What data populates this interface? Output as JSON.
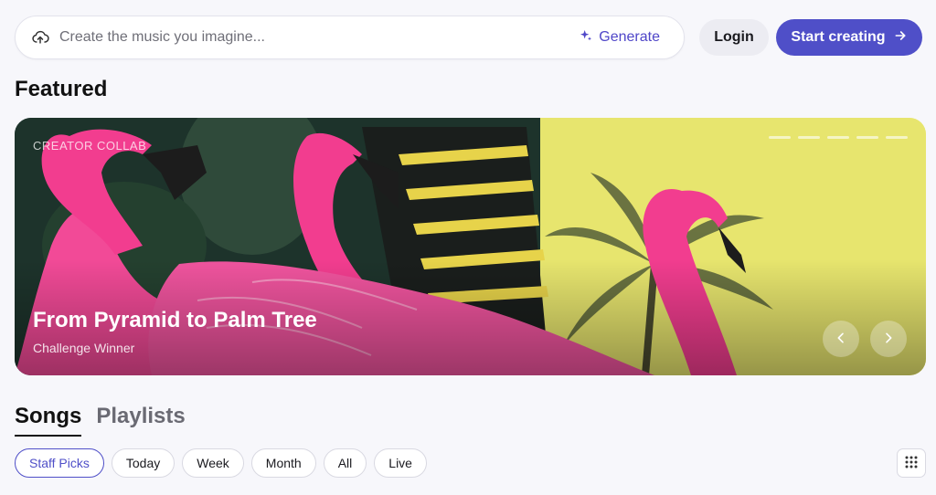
{
  "search": {
    "placeholder": "Create the music you imagine...",
    "generate_label": "Generate"
  },
  "header": {
    "login_label": "Login",
    "start_label": "Start creating"
  },
  "featured": {
    "title": "Featured",
    "banner": {
      "label": "CREATOR COLLAB",
      "title": "From Pyramid to Palm Tree",
      "subtitle": "Challenge Winner",
      "slides": 5,
      "active_slide": 1
    }
  },
  "tabs": [
    {
      "label": "Songs",
      "active": true
    },
    {
      "label": "Playlists",
      "active": false
    }
  ],
  "filters": [
    {
      "label": "Staff Picks",
      "active": true
    },
    {
      "label": "Today",
      "active": false
    },
    {
      "label": "Week",
      "active": false
    },
    {
      "label": "Month",
      "active": false
    },
    {
      "label": "All",
      "active": false
    },
    {
      "label": "Live",
      "active": false
    }
  ],
  "icons": {
    "upload": "cloud-upload-icon",
    "sparkle": "sparkle-icon",
    "arrow": "arrow-right-icon",
    "prev": "chevron-left-icon",
    "next": "chevron-right-icon",
    "grid": "grid-icon"
  },
  "colors": {
    "accent": "#4f4fc8",
    "flamingo": "#f23d8f",
    "banner_yellow": "#e8e66f"
  }
}
